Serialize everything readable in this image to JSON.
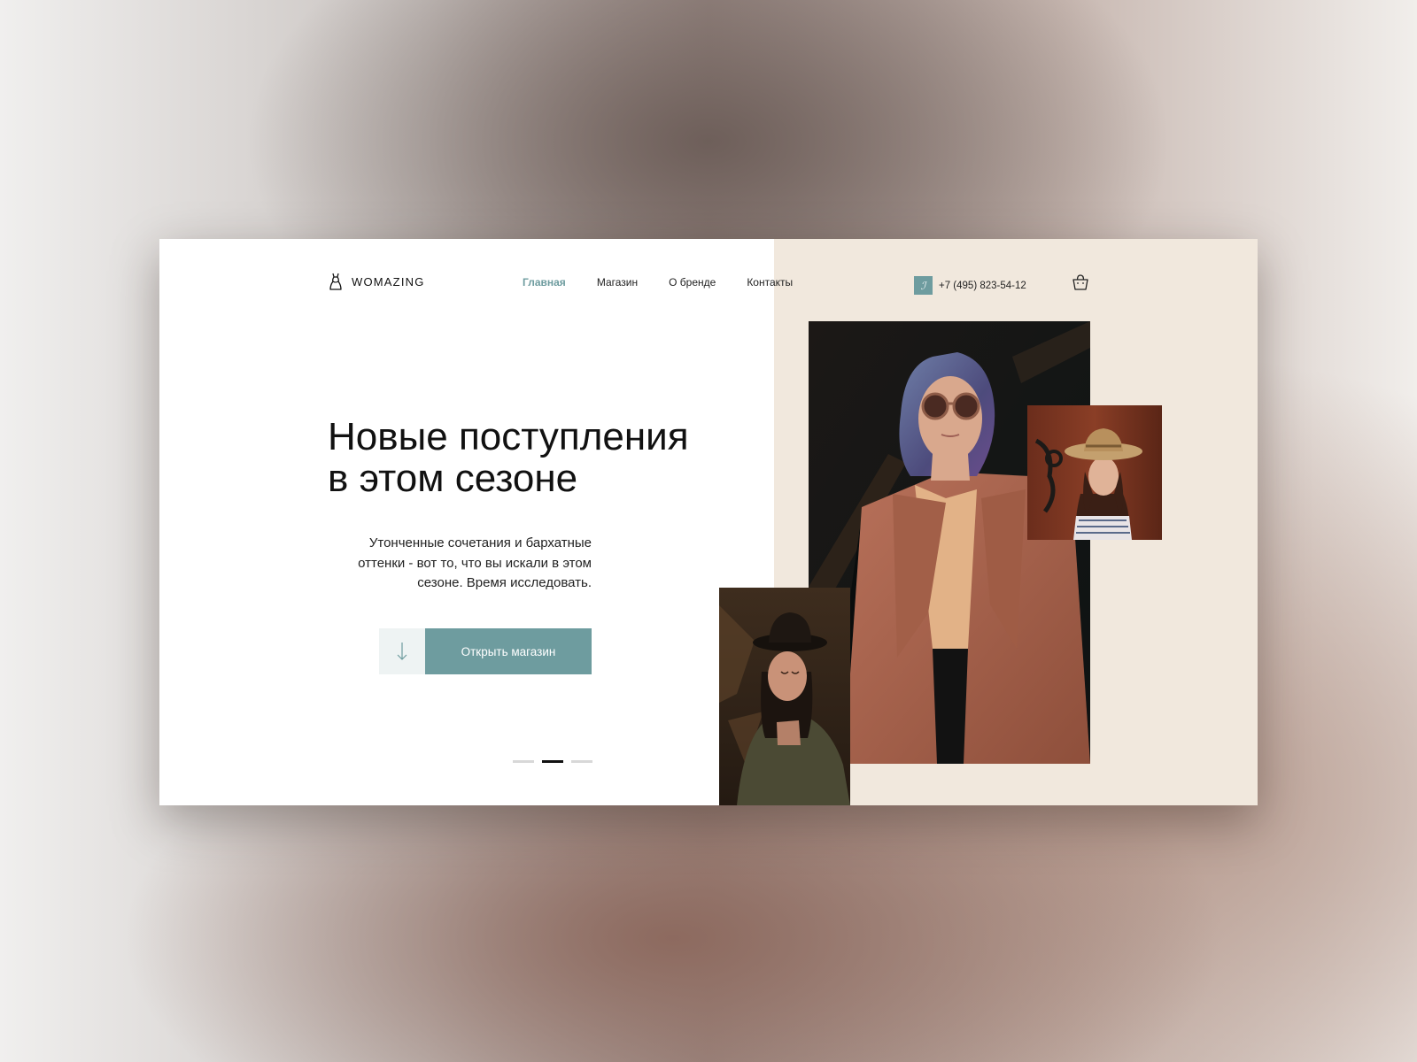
{
  "brand": {
    "name": "WOMAZING"
  },
  "nav": {
    "items": [
      {
        "label": "Главная",
        "active": true
      },
      {
        "label": "Магазин",
        "active": false
      },
      {
        "label": "О бренде",
        "active": false
      },
      {
        "label": "Контакты",
        "active": false
      }
    ]
  },
  "header": {
    "phone": "+7 (495) 823-54-12",
    "phone_icon": "phone-icon",
    "cart_icon": "shopping-bag-icon"
  },
  "hero": {
    "title_lines": [
      "Новые поступления",
      "в этом сезоне"
    ],
    "description_lines": [
      "Утонченные сочетания и бархатные",
      "оттенки - вот то, что вы искали в этом",
      "сезоне. Время исследовать."
    ],
    "cta_label": "Открыть магазин",
    "arrow_icon": "arrow-down-icon"
  },
  "slider": {
    "count": 3,
    "active_index": 1
  },
  "colors": {
    "accent": "#6e9c9f",
    "beige": "#f1e8dd",
    "text": "#111111"
  }
}
